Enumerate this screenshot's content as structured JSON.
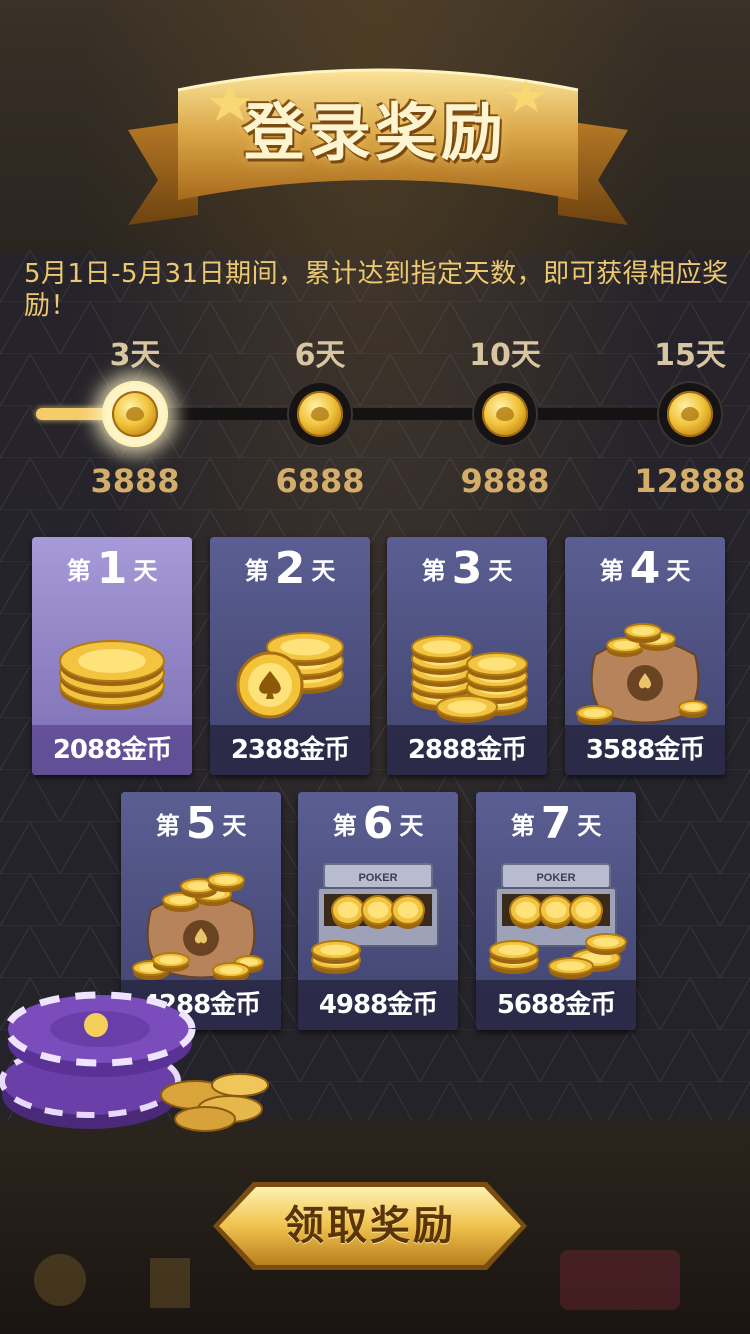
{
  "header": {
    "title": "登录奖励"
  },
  "description": "5月1日-5月31日期间，累计达到指定天数，即可获得相应奖励！",
  "progress": {
    "value": 3,
    "milestones": [
      {
        "day": "3天",
        "amount": "3888"
      },
      {
        "day": "6天",
        "amount": "6888"
      },
      {
        "day": "10天",
        "amount": "9888"
      },
      {
        "day": "15天",
        "amount": "12888"
      }
    ]
  },
  "cards": [
    {
      "prefix": "第",
      "num": "1",
      "suffix": "天",
      "reward": "2088金币",
      "art": "coins-stack-icon"
    },
    {
      "prefix": "第",
      "num": "2",
      "suffix": "天",
      "reward": "2388金币",
      "art": "coins-pile-icon"
    },
    {
      "prefix": "第",
      "num": "3",
      "suffix": "天",
      "reward": "2888金币",
      "art": "coin-stacks-icon"
    },
    {
      "prefix": "第",
      "num": "4",
      "suffix": "天",
      "reward": "3588金币",
      "art": "coin-bag-icon"
    },
    {
      "prefix": "第",
      "num": "5",
      "suffix": "天",
      "reward": "4288金币",
      "art": "coin-bag-full-icon"
    },
    {
      "prefix": "第",
      "num": "6",
      "suffix": "天",
      "reward": "4988金币",
      "art": "poker-case-icon",
      "case_label": "POKER"
    },
    {
      "prefix": "第",
      "num": "7",
      "suffix": "天",
      "reward": "5688金币",
      "art": "poker-case-full-icon",
      "case_label": "POKER"
    }
  ],
  "button": {
    "label": "领取奖励"
  },
  "colors": {
    "gold": "#f4cd6a",
    "desc_text": "#ecc870",
    "card": "#4c5080",
    "card_active": "#8f82c8",
    "amount": "#d4ad6a"
  }
}
